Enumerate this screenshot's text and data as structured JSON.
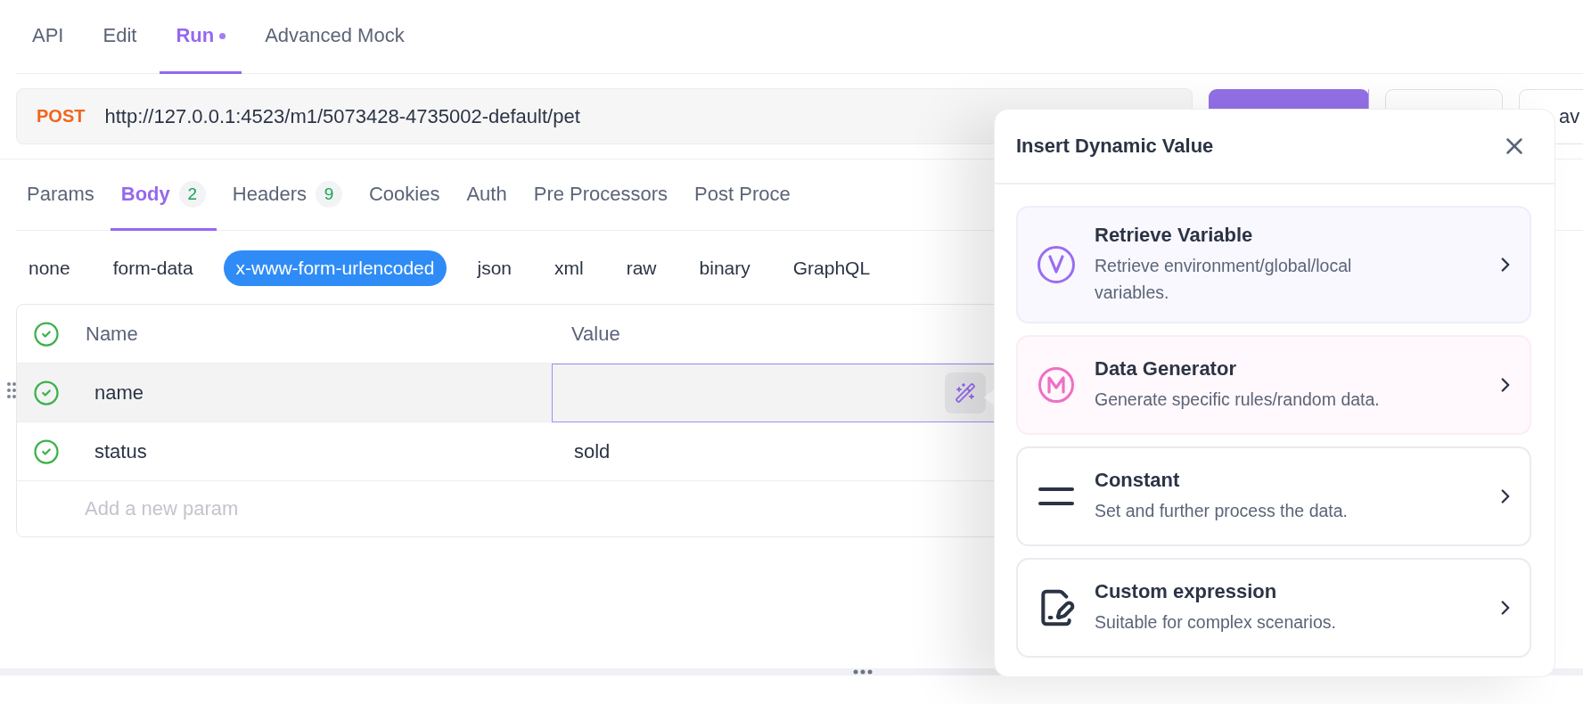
{
  "top_tabs": [
    {
      "label": "API",
      "selected": false,
      "modified": false
    },
    {
      "label": "Edit",
      "selected": false,
      "modified": false
    },
    {
      "label": "Run",
      "selected": true,
      "modified": true
    },
    {
      "label": "Advanced Mock",
      "selected": false,
      "modified": false
    }
  ],
  "request": {
    "method": "POST",
    "url": "http://127.0.0.1:4523/m1/5073428-4735002-default/pet"
  },
  "partial_button": {
    "label": "av"
  },
  "request_tabs": [
    {
      "label": "Params",
      "selected": false
    },
    {
      "label": "Body",
      "badge": "2",
      "selected": true
    },
    {
      "label": "Headers",
      "badge": "9",
      "selected": false
    },
    {
      "label": "Cookies",
      "selected": false
    },
    {
      "label": "Auth",
      "selected": false
    },
    {
      "label": "Pre Processors",
      "selected": false
    },
    {
      "label": "Post Proce",
      "selected": false
    }
  ],
  "body_types": [
    {
      "label": "none",
      "selected": false
    },
    {
      "label": "form-data",
      "selected": false
    },
    {
      "label": "x-www-form-urlencoded",
      "selected": true
    },
    {
      "label": "json",
      "selected": false
    },
    {
      "label": "xml",
      "selected": false
    },
    {
      "label": "raw",
      "selected": false
    },
    {
      "label": "binary",
      "selected": false
    },
    {
      "label": "GraphQL",
      "selected": false
    }
  ],
  "params_table": {
    "header_checked": true,
    "columns": [
      "Name",
      "Value"
    ],
    "rows": [
      {
        "checked": true,
        "name": "name",
        "selected": true
      },
      {
        "checked": true,
        "name": "status",
        "value": "sold",
        "selected": false
      }
    ],
    "placeholder": "Add a new param"
  },
  "dynamic_value_popup": {
    "title": "Insert Dynamic Value",
    "options": [
      {
        "kind": "variable",
        "title": "Retrieve Variable",
        "description": "Retrieve environment/global/local variables."
      },
      {
        "kind": "generator",
        "title": "Data Generator",
        "description": "Generate specific rules/random data."
      },
      {
        "kind": "constant",
        "title": "Constant",
        "description": "Set and further process the data."
      },
      {
        "kind": "expression",
        "title": "Custom expression",
        "description": "Suitable for complex scenarios."
      }
    ]
  }
}
